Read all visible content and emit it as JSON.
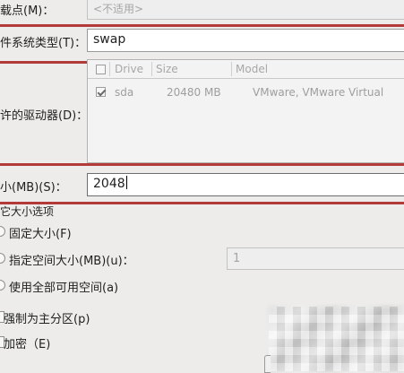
{
  "mount_point": {
    "label": "载点(M)：",
    "placeholder": "<不适用>"
  },
  "fs_type": {
    "label": "件系统类型(T)：",
    "value": "swap"
  },
  "allowed_drives": {
    "label": "许的驱动器(D)：",
    "columns": [
      "Drive",
      "Size",
      "Model"
    ],
    "rows": [
      {
        "checked": true,
        "drive": "sda",
        "size": "20480 MB",
        "model": "VMware, VMware Virtual"
      }
    ]
  },
  "size": {
    "label": "小(MB)(S)：",
    "value": "2048"
  },
  "size_options": {
    "title": "它大小选项",
    "fixed": "固定大小(F)",
    "fill_to": "指定空间大小(MB)(u)：",
    "fill_to_value": "1",
    "fill_all": "使用全部可用空间(a)"
  },
  "force_primary": "强制为主分区(p)",
  "encrypt": "加密（E)"
}
